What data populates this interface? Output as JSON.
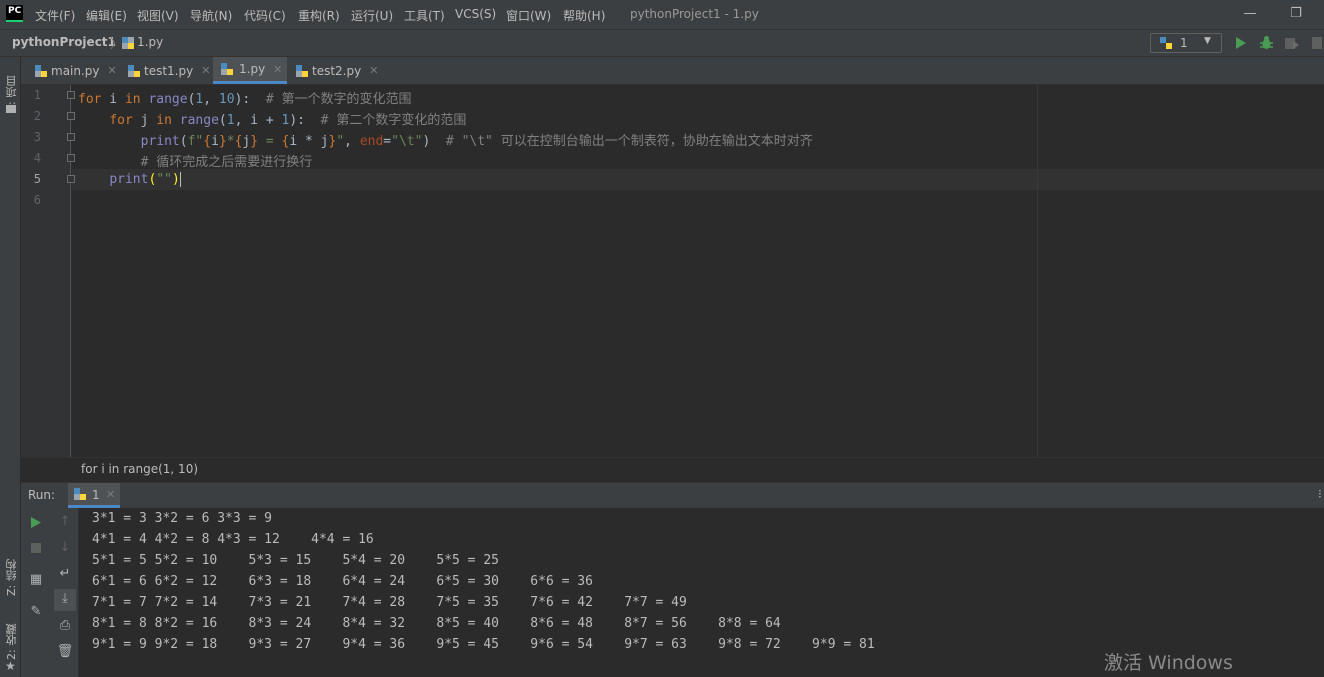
{
  "titlebar": {
    "logo": "PC",
    "menus": [
      "文件(F)",
      "编辑(E)",
      "视图(V)",
      "导航(N)",
      "代码(C)",
      "重构(R)",
      "运行(U)",
      "工具(T)",
      "VCS(S)",
      "窗口(W)",
      "帮助(H)"
    ],
    "window_title": "pythonProject1 - 1.py",
    "minimize": "—",
    "restore": "❐"
  },
  "navbar": {
    "project": "pythonProject1",
    "file": "1.py",
    "run_config": "1"
  },
  "left_strip": {
    "project_tab": "1: 项目",
    "structure_tab": "Z: 结构",
    "favorites_tab": "2: 收藏"
  },
  "tabs": [
    {
      "label": "main.py",
      "active": false
    },
    {
      "label": "test1.py",
      "active": false
    },
    {
      "label": "1.py",
      "active": true
    },
    {
      "label": "test2.py",
      "active": false
    }
  ],
  "editor": {
    "line_numbers": [
      "1",
      "2",
      "3",
      "4",
      "5",
      "6"
    ],
    "current_line": "5",
    "breadcrumb": "for i in range(1, 10)"
  },
  "code": {
    "l1": {
      "kw1": "for",
      "t1": " i ",
      "kw2": "in",
      "t2": " ",
      "fn": "range",
      "t3": "(",
      "n1": "1",
      "t4": ", ",
      "n2": "10",
      "t5": "):  ",
      "cmt": "# 第一个数字的变化范围"
    },
    "l2": {
      "indent": "    ",
      "kw1": "for",
      "t1": " j ",
      "kw2": "in",
      "t2": " ",
      "fn": "range",
      "t3": "(",
      "n1": "1",
      "t4": ", i + ",
      "n2": "1",
      "t5": "):  ",
      "cmt": "# 第二个数字变化的范围"
    },
    "l3": {
      "indent": "        ",
      "fn": "print",
      "t1": "(",
      "s1": "f\"",
      "b1": "{",
      "v1": "i",
      "b2": "}",
      "s2": "*",
      "b3": "{",
      "v2": "j",
      "b4": "}",
      "s3": " = ",
      "b5": "{",
      "v3": "i * j",
      "b6": "}",
      "s4": "\"",
      "t2": ", ",
      "kwarg": "end",
      "t3": "=",
      "s5": "\"\\t\"",
      "t4": ")  ",
      "cmt": "# \"\\t\" 可以在控制台输出一个制表符，协助在输出文本时对齐"
    },
    "l4": {
      "indent": "        ",
      "cmt": "# 循环完成之后需要进行换行"
    },
    "l5": {
      "indent": "    ",
      "fn": "print",
      "t1": "(",
      "s1": "\"\"",
      "t2": ")"
    }
  },
  "run_panel": {
    "label": "Run:",
    "tab": "1",
    "output": [
      "3*1 = 3 3*2 = 6 3*3 = 9",
      "4*1 = 4 4*2 = 8 4*3 = 12    4*4 = 16",
      "5*1 = 5 5*2 = 10    5*3 = 15    5*4 = 20    5*5 = 25",
      "6*1 = 6 6*2 = 12    6*3 = 18    6*4 = 24    6*5 = 30    6*6 = 36",
      "7*1 = 7 7*2 = 14    7*3 = 21    7*4 = 28    7*5 = 35    7*6 = 42    7*7 = 49",
      "8*1 = 8 8*2 = 16    8*3 = 24    8*4 = 32    8*5 = 40    8*6 = 48    8*7 = 56    8*8 = 64",
      "9*1 = 9 9*2 = 18    9*3 = 27    9*4 = 36    9*5 = 45    9*6 = 54    9*7 = 63    9*8 = 72    9*9 = 81"
    ]
  },
  "watermark": "激活 Windows",
  "colors": {
    "keyword": "#cc7832",
    "number": "#6897bb",
    "comment": "#808080",
    "string": "#6a8759",
    "builtin": "#8888c6",
    "run_green": "#499c54",
    "tab_underline": "#4a88c7"
  }
}
